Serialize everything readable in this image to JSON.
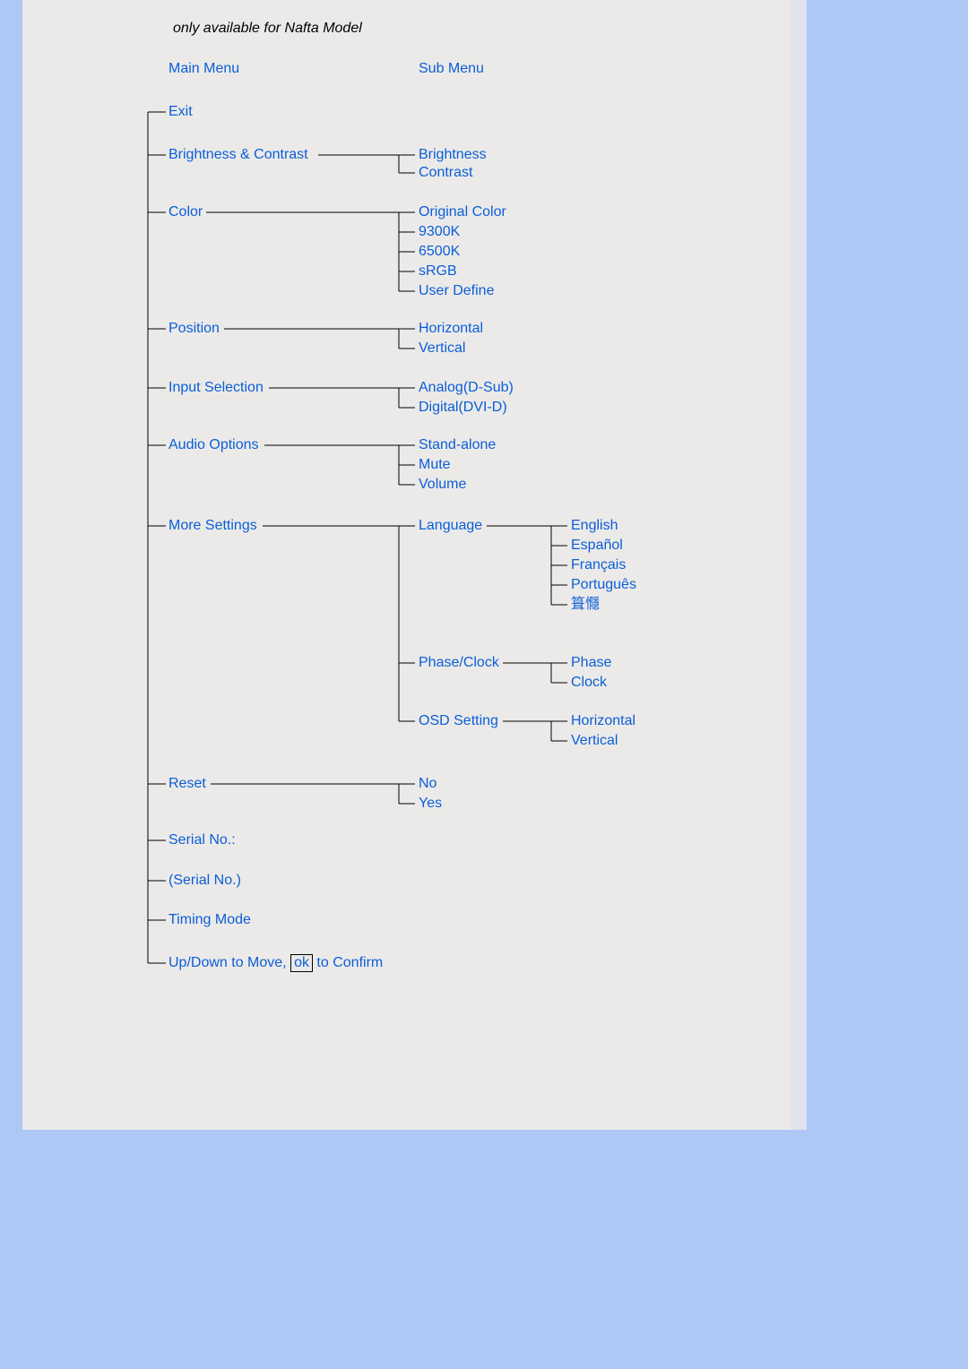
{
  "note": "only available for Nafta Model",
  "headers": {
    "main": "Main Menu",
    "sub": "Sub Menu"
  },
  "main": {
    "exit": "Exit",
    "brightness_contrast": "Brightness & Contrast",
    "color": "Color",
    "position": "Position",
    "input_selection": "Input Selection",
    "audio_options": "Audio Options",
    "more_settings": "More Settings",
    "reset": "Reset",
    "serial_no_label": "Serial No.:",
    "serial_no_value": "(Serial No.)",
    "timing_mode": "Timing Mode",
    "hint_pre": "Up/Down to Move,",
    "hint_ok": "ok",
    "hint_post": "to Confirm"
  },
  "sub": {
    "brightness": "Brightness",
    "contrast": "Contrast",
    "original_color": "Original Color",
    "c9300k": "9300K",
    "c6500k": "6500K",
    "srgb": "sRGB",
    "user_define": "User Define",
    "horizontal": "Horizontal",
    "vertical": "Vertical",
    "analog": "Analog(D-Sub)",
    "digital": "Digital(DVI-D)",
    "stand_alone": "Stand-alone",
    "mute": "Mute",
    "volume": "Volume",
    "language": "Language",
    "phase_clock": "Phase/Clock",
    "osd_setting": "OSD Setting",
    "no": "No",
    "yes": "Yes"
  },
  "lang": {
    "english": "English",
    "espanol": "Español",
    "francais": "Français",
    "portugues": "Português",
    "chinese": "箿㦩"
  },
  "pc": {
    "phase": "Phase",
    "clock": "Clock"
  },
  "osd": {
    "horizontal": "Horizontal",
    "vertical": "Vertical"
  }
}
